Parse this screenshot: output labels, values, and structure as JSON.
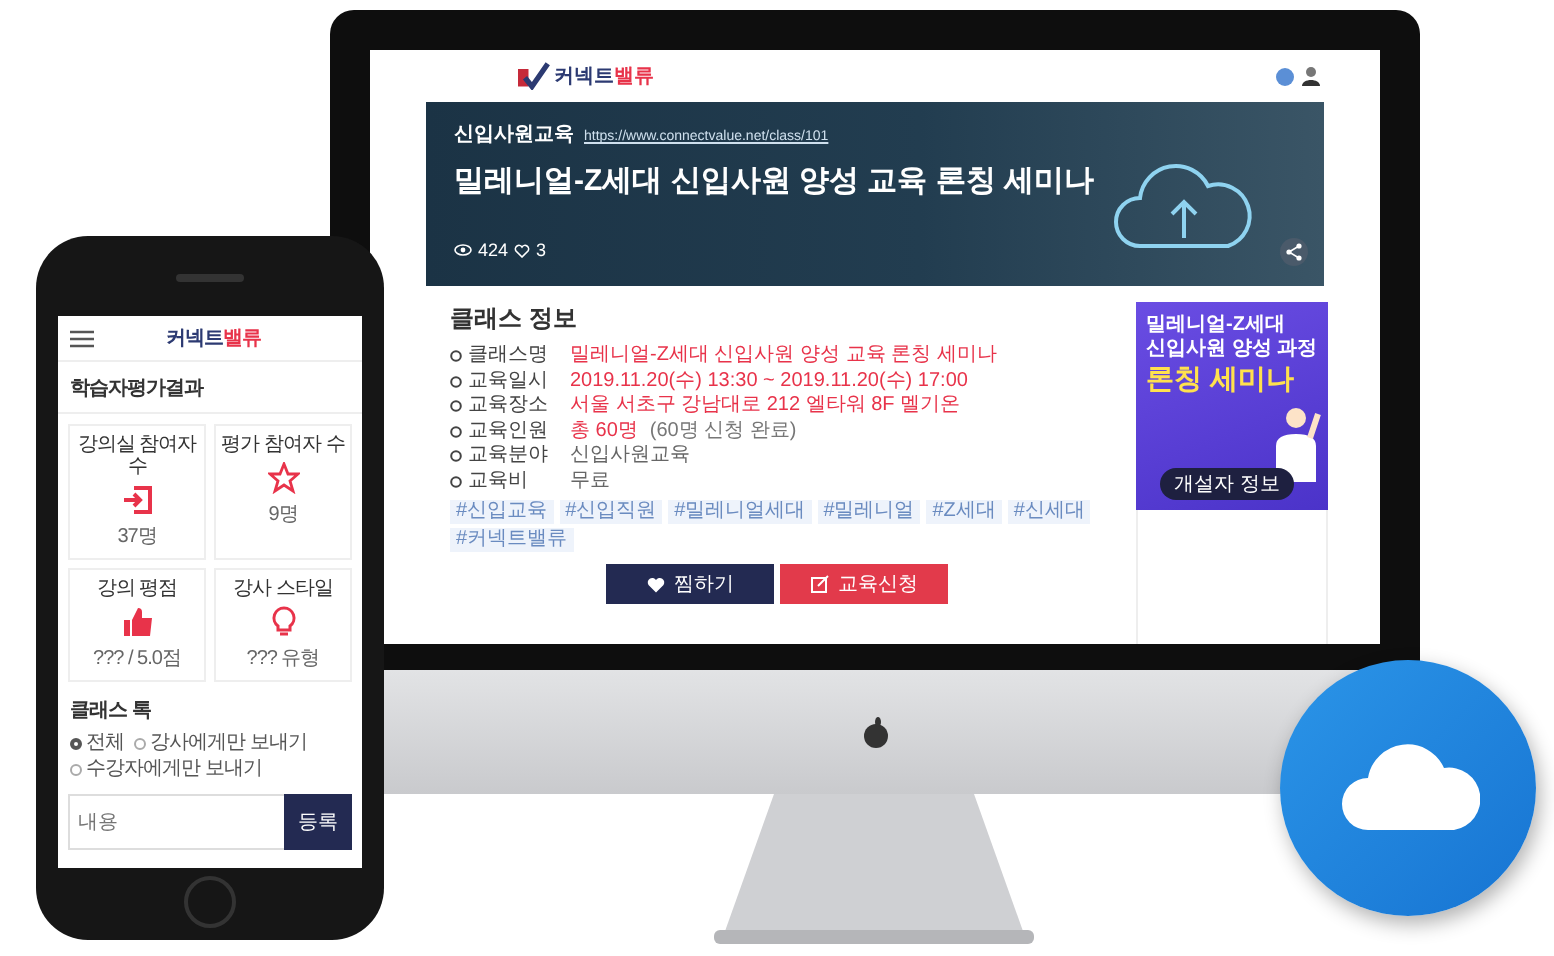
{
  "desktop": {
    "logo": {
      "text": "커넥트",
      "accent": "밸류"
    },
    "banner": {
      "category": "신입사원교육",
      "url": "https://www.connectvalue.net/class/101",
      "title": "밀레니얼-Z세대 신입사원 양성 교육 론칭 세미나",
      "views": "424",
      "likes": "3"
    },
    "info": {
      "heading": "클래스 정보",
      "rows": [
        {
          "label": "클래스명",
          "value": "밀레니얼-Z세대 신입사원 양성 교육 론칭 세미나",
          "highlight": true
        },
        {
          "label": "교육일시",
          "value": "2019.11.20(수) 13:30 ~ 2019.11.20(수) 17:00",
          "highlight": true
        },
        {
          "label": "교육장소",
          "value": "서울 서초구 강남대로 212 엘타워 8F 멜기온",
          "highlight": true
        },
        {
          "label": "교육인원",
          "value": "총 60명",
          "note": "(60명 신청 완료)",
          "highlight": true
        },
        {
          "label": "교육분야",
          "value": "신입사원교육",
          "highlight": false
        },
        {
          "label": "교육비",
          "value": "무료",
          "highlight": false
        }
      ]
    },
    "tags": [
      "#신입교육",
      "#신입직원",
      "#밀레니얼세대",
      "#밀레니얼",
      "#Z세대",
      "#신세대",
      "#커넥트밸류"
    ],
    "buttons": [
      {
        "label": "찜하기",
        "kind": "like"
      },
      {
        "label": "교육신청",
        "kind": "apply"
      }
    ],
    "poster": {
      "lines": [
        "밀레니얼-Z세대",
        "신입사원 양성 과정"
      ],
      "headline": "론칭 세미나",
      "button": "개설자 정보"
    }
  },
  "phone": {
    "logo": {
      "text": "커넥트",
      "accent": "밸류"
    },
    "section_title": "학습자평가결과",
    "cards": [
      {
        "title": "강의실 참여자 수",
        "value": "37명",
        "kind": "enter"
      },
      {
        "title": "평가 참여자 수",
        "value": "9명",
        "kind": "star"
      },
      {
        "title": "강의 평점",
        "value": "??? / 5.0점",
        "kind": "thumb"
      },
      {
        "title": "강사 스타일",
        "value": "??? 유형",
        "kind": "bulb"
      }
    ],
    "talk_title": "클래스 톡",
    "recipients": [
      {
        "label": "전체",
        "selected": true
      },
      {
        "label": "강사에게만 보내기",
        "selected": false
      },
      {
        "label": "수강자에게만 보내기",
        "selected": false
      }
    ],
    "message": {
      "placeholder": "내용"
    },
    "send_button": "등록"
  }
}
